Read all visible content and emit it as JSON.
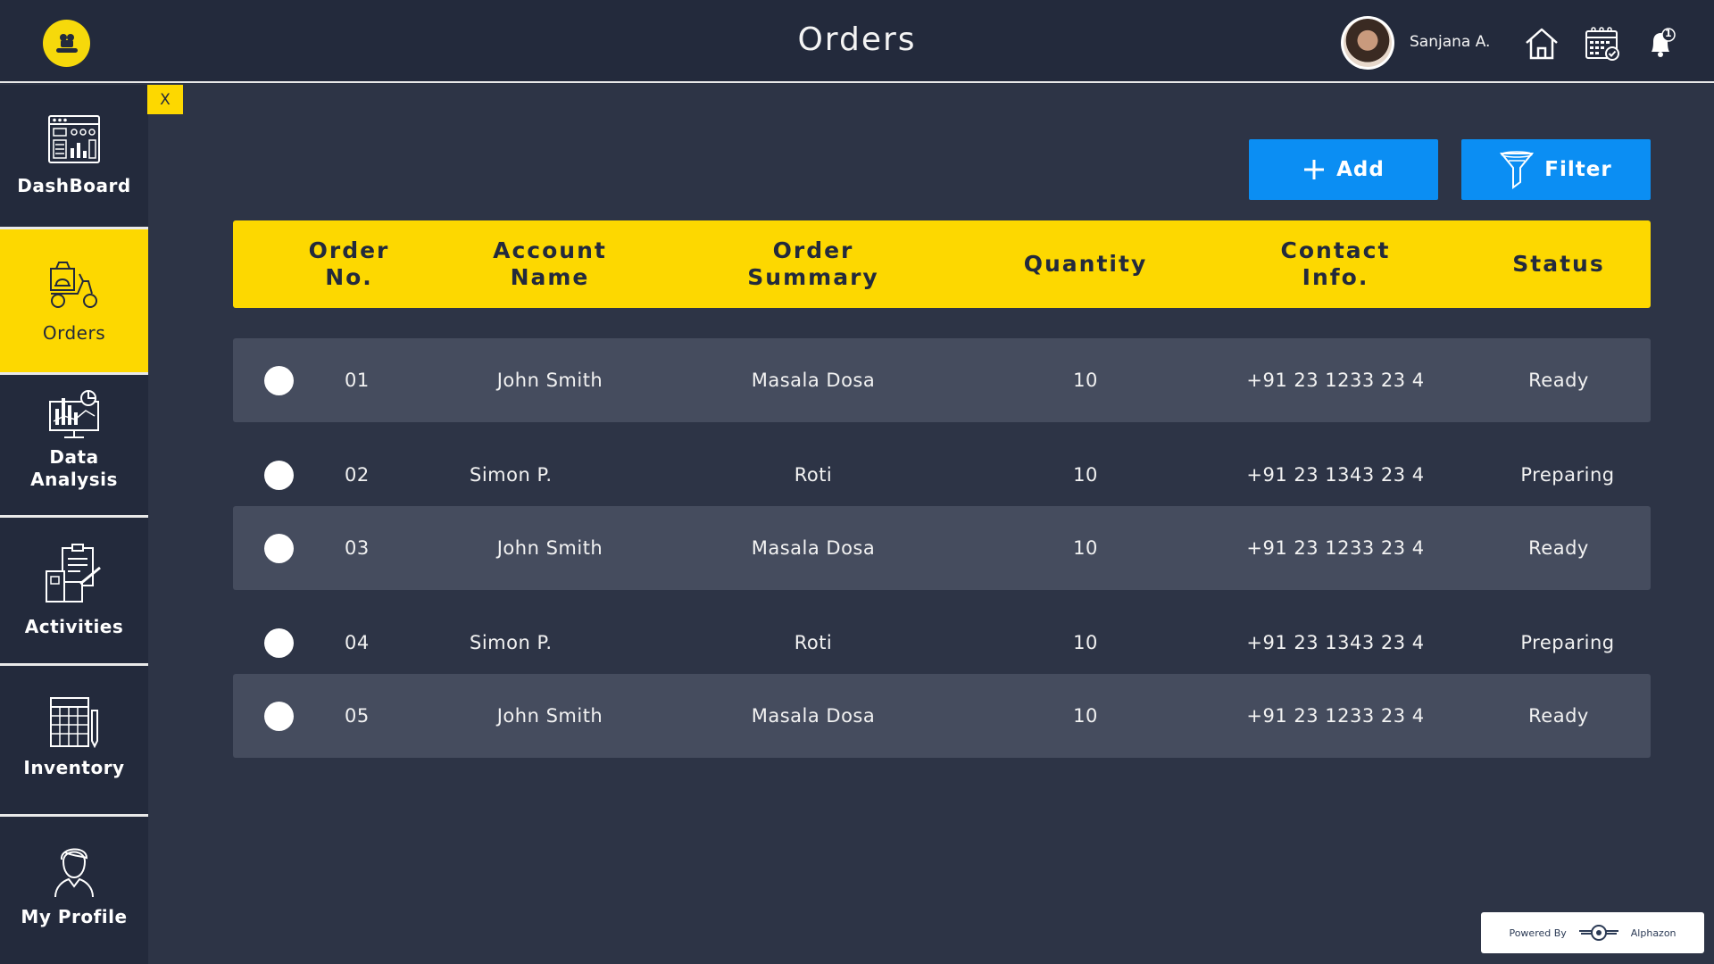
{
  "header": {
    "title": "Orders",
    "user_name": "Sanjana A.",
    "notification_count": "1"
  },
  "sidebar": {
    "close_label": "X",
    "items": [
      {
        "label": "DashBoard",
        "icon": "dashboard-icon"
      },
      {
        "label": "Orders",
        "icon": "delivery-scooter-icon",
        "active": true
      },
      {
        "label": "Data\nAnalysis",
        "icon": "data-analysis-icon"
      },
      {
        "label": "Activities",
        "icon": "clipboard-activities-icon"
      },
      {
        "label": "Inventory",
        "icon": "inventory-sheet-icon"
      },
      {
        "label": "My Profile",
        "icon": "profile-icon"
      }
    ]
  },
  "toolbar": {
    "add_label": "Add",
    "filter_label": "Filter"
  },
  "table": {
    "columns": [
      "Order No.",
      "Account Name",
      "Order Summary",
      "Quantity",
      "Contact Info.",
      "Status"
    ],
    "rows": [
      {
        "order_no": "01",
        "account": "John Smith",
        "summary": "Masala Dosa",
        "quantity": "10",
        "contact": "+91 23 1233 23 4",
        "status": "Ready"
      },
      {
        "order_no": "02",
        "account": "Simon P.",
        "summary": "Roti",
        "quantity": "10",
        "contact": "+91 23 1343 23 4",
        "status": "Preparing"
      },
      {
        "order_no": "03",
        "account": "John Smith",
        "summary": "Masala Dosa",
        "quantity": "10",
        "contact": "+91 23 1233 23 4",
        "status": "Ready"
      },
      {
        "order_no": "04",
        "account": "Simon P.",
        "summary": "Roti",
        "quantity": "10",
        "contact": "+91 23 1343 23 4",
        "status": "Preparing"
      },
      {
        "order_no": "05",
        "account": "John Smith",
        "summary": "Masala Dosa",
        "quantity": "10",
        "contact": "+91 23 1233 23 4",
        "status": "Ready"
      }
    ]
  },
  "footer": {
    "powered_by": "Powered By",
    "brand": "Alphazon"
  },
  "colors": {
    "background": "#2d3446",
    "header": "#232a3c",
    "accent_yellow": "#fdd800",
    "button_blue": "#0b8ef3",
    "row_shade": "#454c5e"
  }
}
